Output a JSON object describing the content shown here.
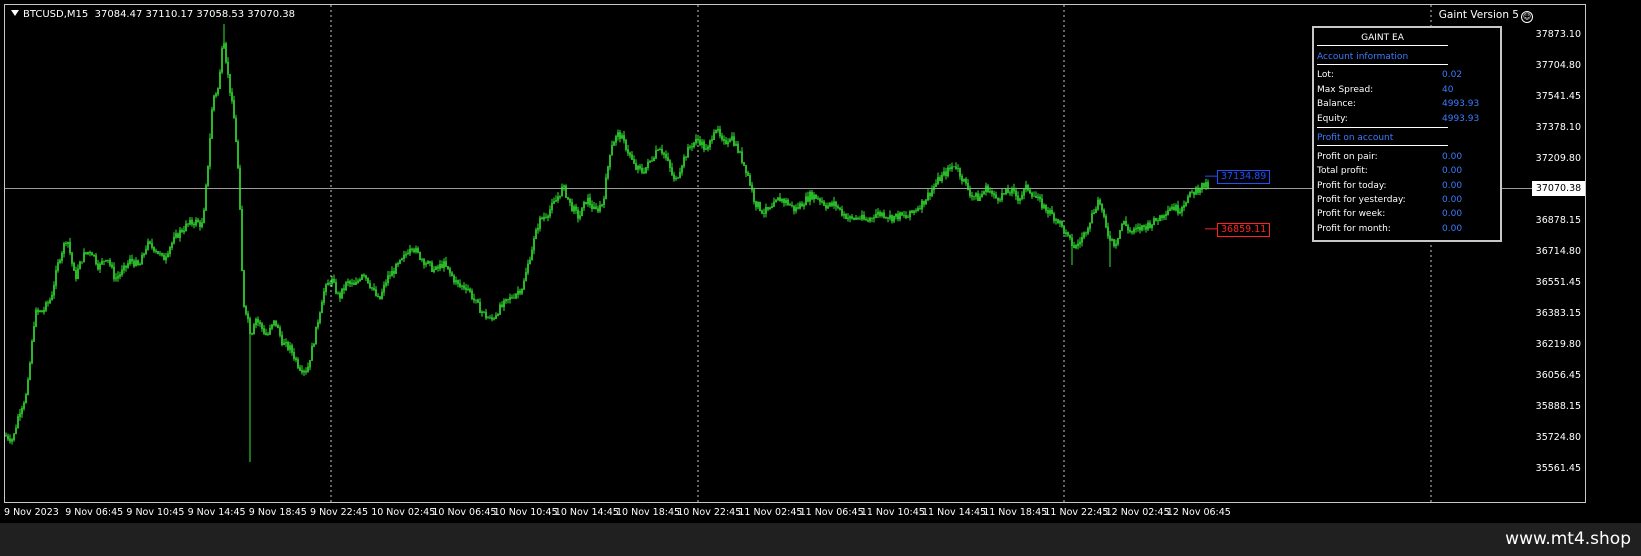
{
  "header": {
    "symbol": "BTCUSD,M15",
    "ohlc": "37084.47 37110.17 37058.53 37070.38",
    "ea_version": "Gaint Version 5"
  },
  "price_axis": {
    "labels": [
      "37873.10",
      "37704.80",
      "37541.45",
      "37378.10",
      "37209.80",
      "37046.45",
      "36878.15",
      "36714.80",
      "36551.45",
      "36383.15",
      "36219.80",
      "36056.45",
      "35888.15",
      "35724.80",
      "35561.45"
    ],
    "current_price": "37070.38"
  },
  "time_axis": {
    "labels": [
      "9 Nov 2023",
      "9 Nov 06:45",
      "9 Nov 10:45",
      "9 Nov 14:45",
      "9 Nov 18:45",
      "9 Nov 22:45",
      "10 Nov 02:45",
      "10 Nov 06:45",
      "10 Nov 10:45",
      "10 Nov 14:45",
      "10 Nov 18:45",
      "10 Nov 22:45",
      "11 Nov 02:45",
      "11 Nov 06:45",
      "11 Nov 10:45",
      "11 Nov 14:45",
      "11 Nov 18:45",
      "11 Nov 22:45",
      "12 Nov 02:45",
      "12 Nov 06:45"
    ]
  },
  "levels": {
    "buy_level": "37134.89",
    "sell_level": "36859.11"
  },
  "ea_panel": {
    "title": "GAINT EA",
    "account_section": "Account information",
    "account_rows": [
      {
        "label": "Lot:",
        "value": "0.02"
      },
      {
        "label": "Max Spread:",
        "value": "40"
      },
      {
        "label": "Balance:",
        "value": "4993.93"
      },
      {
        "label": "Equity:",
        "value": "4993.93"
      }
    ],
    "profit_section": "Profit on account",
    "profit_rows": [
      {
        "label": "Profit on pair:",
        "value": "0.00"
      },
      {
        "label": "Total profit:",
        "value": "0.00"
      },
      {
        "label": "Profit for today:",
        "value": "0.00"
      },
      {
        "label": "Profit for yesterday:",
        "value": "0.00"
      },
      {
        "label": "Profit for week:",
        "value": "0.00"
      },
      {
        "label": "Profit for month:",
        "value": "0.00"
      }
    ]
  },
  "footer": {
    "watermark": "www.mt4.shop"
  },
  "colors": {
    "candle": "#32e632",
    "buy": "#1e50ff",
    "sell": "#ff2020",
    "panel_value": "#3b7bff"
  },
  "chart_data": {
    "type": "line",
    "ylim": [
      35561.45,
      37873.1
    ],
    "path_points": [
      [
        0,
        35780
      ],
      [
        8,
        35760
      ],
      [
        14,
        35900
      ],
      [
        22,
        36000
      ],
      [
        30,
        36420
      ],
      [
        38,
        36430
      ],
      [
        46,
        36500
      ],
      [
        54,
        36700
      ],
      [
        62,
        36820
      ],
      [
        70,
        36600
      ],
      [
        78,
        36720
      ],
      [
        86,
        36750
      ],
      [
        94,
        36660
      ],
      [
        102,
        36720
      ],
      [
        110,
        36600
      ],
      [
        118,
        36640
      ],
      [
        126,
        36700
      ],
      [
        134,
        36660
      ],
      [
        142,
        36780
      ],
      [
        150,
        36760
      ],
      [
        158,
        36700
      ],
      [
        166,
        36780
      ],
      [
        174,
        36840
      ],
      [
        182,
        36880
      ],
      [
        190,
        36900
      ],
      [
        198,
        36880
      ],
      [
        203,
        37200
      ],
      [
        208,
        37550
      ],
      [
        214,
        37600
      ],
      [
        218,
        37900
      ],
      [
        222,
        37700
      ],
      [
        226,
        37550
      ],
      [
        230,
        37400
      ],
      [
        234,
        37100
      ],
      [
        238,
        36480
      ],
      [
        242,
        36420
      ],
      [
        246,
        36300
      ],
      [
        250,
        36400
      ],
      [
        256,
        36350
      ],
      [
        262,
        36300
      ],
      [
        270,
        36380
      ],
      [
        278,
        36260
      ],
      [
        286,
        36230
      ],
      [
        294,
        36140
      ],
      [
        302,
        36120
      ],
      [
        310,
        36300
      ],
      [
        318,
        36520
      ],
      [
        326,
        36600
      ],
      [
        334,
        36500
      ],
      [
        342,
        36580
      ],
      [
        350,
        36560
      ],
      [
        358,
        36640
      ],
      [
        366,
        36560
      ],
      [
        374,
        36480
      ],
      [
        382,
        36600
      ],
      [
        390,
        36650
      ],
      [
        398,
        36700
      ],
      [
        406,
        36780
      ],
      [
        414,
        36720
      ],
      [
        422,
        36680
      ],
      [
        430,
        36640
      ],
      [
        438,
        36680
      ],
      [
        446,
        36620
      ],
      [
        454,
        36560
      ],
      [
        462,
        36560
      ],
      [
        470,
        36480
      ],
      [
        478,
        36420
      ],
      [
        486,
        36380
      ],
      [
        494,
        36440
      ],
      [
        502,
        36480
      ],
      [
        510,
        36520
      ],
      [
        518,
        36560
      ],
      [
        526,
        36740
      ],
      [
        534,
        36900
      ],
      [
        542,
        36940
      ],
      [
        550,
        37000
      ],
      [
        558,
        37080
      ],
      [
        566,
        36980
      ],
      [
        574,
        36920
      ],
      [
        582,
        37020
      ],
      [
        590,
        36950
      ],
      [
        598,
        37000
      ],
      [
        606,
        37300
      ],
      [
        614,
        37360
      ],
      [
        622,
        37280
      ],
      [
        630,
        37180
      ],
      [
        638,
        37160
      ],
      [
        646,
        37220
      ],
      [
        654,
        37300
      ],
      [
        662,
        37220
      ],
      [
        670,
        37100
      ],
      [
        678,
        37220
      ],
      [
        686,
        37300
      ],
      [
        694,
        37330
      ],
      [
        702,
        37260
      ],
      [
        710,
        37400
      ],
      [
        718,
        37300
      ],
      [
        726,
        37350
      ],
      [
        734,
        37260
      ],
      [
        742,
        37160
      ],
      [
        750,
        37000
      ],
      [
        758,
        36950
      ],
      [
        766,
        36960
      ],
      [
        774,
        37020
      ],
      [
        782,
        37000
      ],
      [
        790,
        36960
      ],
      [
        798,
        37000
      ],
      [
        806,
        37040
      ],
      [
        814,
        37020
      ],
      [
        822,
        36980
      ],
      [
        830,
        36990
      ],
      [
        838,
        36940
      ],
      [
        846,
        36910
      ],
      [
        854,
        36920
      ],
      [
        862,
        36900
      ],
      [
        870,
        36940
      ],
      [
        878,
        36940
      ],
      [
        886,
        36920
      ],
      [
        894,
        36930
      ],
      [
        902,
        36920
      ],
      [
        910,
        36960
      ],
      [
        918,
        37000
      ],
      [
        926,
        37060
      ],
      [
        934,
        37120
      ],
      [
        942,
        37160
      ],
      [
        950,
        37200
      ],
      [
        958,
        37120
      ],
      [
        966,
        37040
      ],
      [
        974,
        37020
      ],
      [
        982,
        37080
      ],
      [
        990,
        37020
      ],
      [
        998,
        37040
      ],
      [
        1006,
        37060
      ],
      [
        1014,
        37020
      ],
      [
        1022,
        37080
      ],
      [
        1030,
        37030
      ],
      [
        1038,
        36980
      ],
      [
        1046,
        36940
      ],
      [
        1054,
        36900
      ],
      [
        1062,
        36820
      ],
      [
        1070,
        36760
      ],
      [
        1078,
        36820
      ],
      [
        1086,
        36920
      ],
      [
        1094,
        37020
      ],
      [
        1102,
        36840
      ],
      [
        1110,
        36780
      ],
      [
        1118,
        36900
      ],
      [
        1126,
        36840
      ],
      [
        1134,
        36860
      ],
      [
        1142,
        36880
      ],
      [
        1150,
        36900
      ],
      [
        1158,
        36940
      ],
      [
        1166,
        36980
      ],
      [
        1174,
        36960
      ],
      [
        1182,
        37020
      ],
      [
        1190,
        37060
      ],
      [
        1198,
        37090
      ],
      [
        1206,
        37075
      ]
    ]
  }
}
